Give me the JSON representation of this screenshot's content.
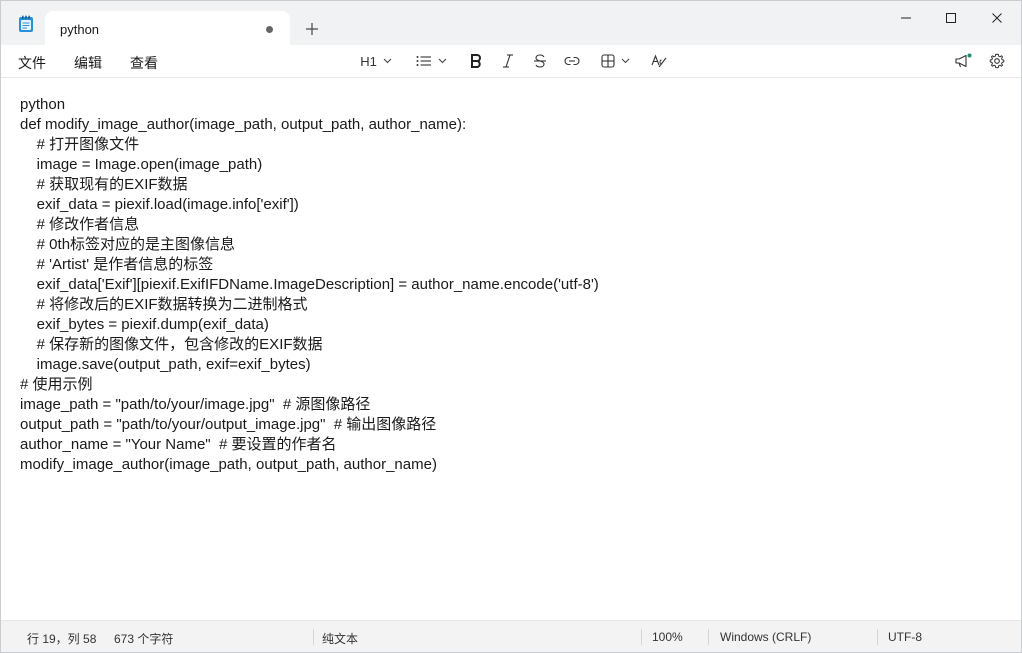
{
  "tab": {
    "title": "python"
  },
  "menu": {
    "file": "文件",
    "edit": "编辑",
    "view": "查看"
  },
  "toolbar": {
    "heading": "H1"
  },
  "document": {
    "lines": [
      "python",
      "def modify_image_author(image_path, output_path, author_name):",
      "    # 打开图像文件",
      "    image = Image.open(image_path)",
      "    # 获取现有的EXIF数据",
      "    exif_data = piexif.load(image.info['exif'])",
      "    # 修改作者信息",
      "    # 0th标签对应的是主图像信息",
      "    # 'Artist' 是作者信息的标签",
      "    exif_data['Exif'][piexif.ExifIFDName.ImageDescription] = author_name.encode('utf-8')",
      "    # 将修改后的EXIF数据转换为二进制格式",
      "    exif_bytes = piexif.dump(exif_data)",
      "    # 保存新的图像文件，包含修改的EXIF数据",
      "    image.save(output_path, exif=exif_bytes)",
      "# 使用示例",
      "image_path = \"path/to/your/image.jpg\"  # 源图像路径",
      "output_path = \"path/to/your/output_image.jpg\"  # 输出图像路径",
      "author_name = \"Your Name\"  # 要设置的作者名",
      "modify_image_author(image_path, output_path, author_name)"
    ]
  },
  "status": {
    "position": "行 19，列 58",
    "char_count": "673 个字符",
    "format": "纯文本",
    "zoom": "100%",
    "line_ending": "Windows (CRLF)",
    "encoding": "UTF-8"
  },
  "colors": {
    "notification_dot": "#1f8a70",
    "app_icon": "#2b8fd6"
  },
  "icons": {
    "app": "notepad-icon",
    "minimize": "minimize-icon",
    "maximize": "maximize-icon",
    "close": "close-icon",
    "list": "list-icon",
    "bold": "bold-icon",
    "italic": "italic-icon",
    "strikethrough": "strikethrough-icon",
    "link": "link-icon",
    "table": "table-icon",
    "spellcheck": "spellcheck-icon",
    "announcement": "megaphone-icon",
    "settings": "gear-icon"
  }
}
